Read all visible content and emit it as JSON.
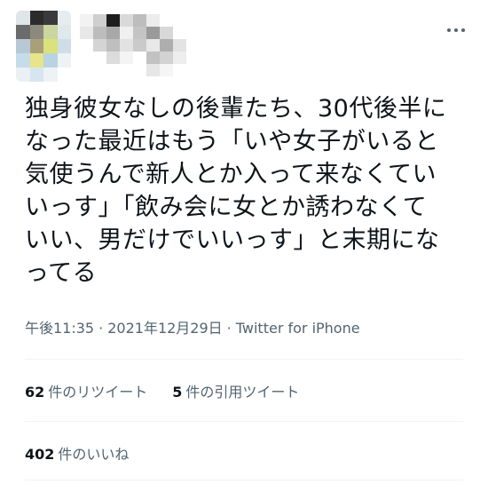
{
  "tweet": {
    "lines": [
      "独身彼女なしの後輩たち、30代後半に",
      "なった最近はもう「いや女子がいると",
      "気使うんで新人とか入って来なくてい",
      "いっす」「飲み会に女とか誘わなくて",
      "いい、男だけでいいっす」と末期にな",
      "ってる"
    ],
    "time": "午後11:35",
    "date": "2021年12月29日",
    "source": "Twitter for iPhone"
  },
  "stats": {
    "retweets": {
      "count": "62",
      "label": "件のリツイート"
    },
    "quotes": {
      "count": "5",
      "label": "件の引用ツイート"
    },
    "likes": {
      "count": "402",
      "label": "件のいいね"
    }
  },
  "colors": {
    "text": "#0f1419",
    "secondary": "#536471",
    "divider": "#eff3f4"
  },
  "icons": {
    "more": "more-horizontal-icon"
  }
}
